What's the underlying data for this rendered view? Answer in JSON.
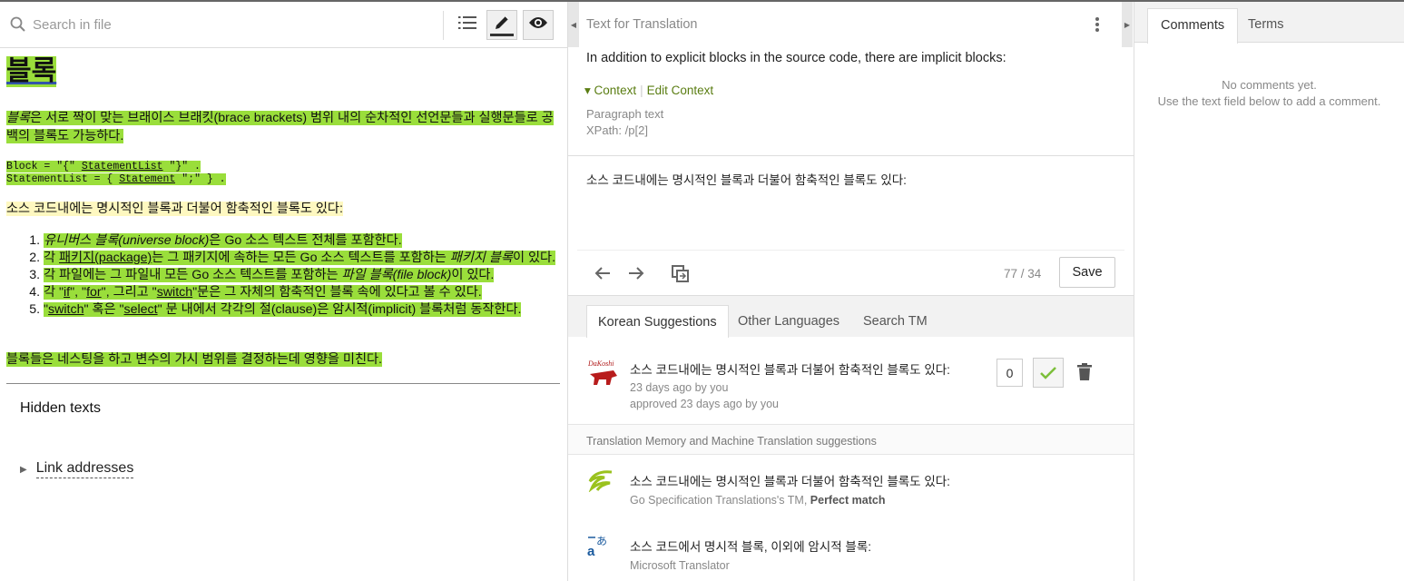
{
  "left": {
    "search_placeholder": "Search in file",
    "doc": {
      "heading": "블록",
      "p1_em": "블록",
      "p1_rest": "은 서로 짝이 맞는 브래이스 브래킷(brace brackets) 범위 내의 순차적인 선언문들과 실행문들로 공백의 블록도 가능하다.",
      "code_line1_a": "Block = \"{\" ",
      "code_line1_link": "StatementList",
      "code_line1_b": " \"}\" .",
      "code_line2_a": "StatementList = { ",
      "code_line2_link": "Statement",
      "code_line2_b": " \";\" } .",
      "p2": "소스 코드내에는 명시적인 블록과 더불어 함축적인 블록도 있다:",
      "items": [
        {
          "parts": [
            {
              "t": "유니버스 블록(universe block)",
              "em": true
            },
            {
              "t": "은 Go 소스 텍스트 전체를 포함한다."
            }
          ]
        },
        {
          "parts": [
            {
              "t": "각 "
            },
            {
              "t": "패키지(package)",
              "u": true
            },
            {
              "t": "는 그 패키지에 속하는 모든 Go 소스 텍스트를 포함하는 "
            },
            {
              "t": "패키지 블록",
              "em": true
            },
            {
              "t": "이 있다."
            }
          ]
        },
        {
          "parts": [
            {
              "t": "각 파일에는 그 파일내 모든 Go 소스 텍스트를 포함하는 "
            },
            {
              "t": "파일 블록(file block)",
              "em": true
            },
            {
              "t": "이 있다."
            }
          ]
        },
        {
          "parts": [
            {
              "t": "각 \""
            },
            {
              "t": "if",
              "u": true
            },
            {
              "t": "\", \""
            },
            {
              "t": "for",
              "u": true
            },
            {
              "t": "\", 그리고 \""
            },
            {
              "t": "switch",
              "u": true
            },
            {
              "t": "\"문은 그 자체의 함축적인 블록 속에 있다고 볼 수 있다."
            }
          ]
        },
        {
          "parts": [
            {
              "t": "\""
            },
            {
              "t": "switch",
              "u": true
            },
            {
              "t": "\" 혹은 \""
            },
            {
              "t": "select",
              "u": true
            },
            {
              "t": "\" 문 내에서 각각의 절(clause)은 암시적(implicit) 블록처럼 동작한다."
            }
          ]
        }
      ],
      "p3": "블록들은 네스팅을 하고 변수의 가시 범위를 결정하는데 영향을 미친다."
    },
    "hidden_texts": "Hidden texts",
    "link_addresses": "Link addresses"
  },
  "middle": {
    "header": "Text for Translation",
    "source_text": "In addition to explicit blocks in the source code, there are implicit blocks:",
    "context_label": "Context",
    "edit_context_label": "Edit Context",
    "meta_type": "Paragraph text",
    "meta_xpath": "XPath: /p[2]",
    "translation": "소스 코드내에는 명시적인 블록과 더불어 함축적인 블록도 있다:",
    "counter": "77 / 34",
    "save_label": "Save",
    "tabs": [
      "Korean Suggestions",
      "Other Languages",
      "Search TM"
    ],
    "suggestion": {
      "text": "소스 코드내에는 명시적인 블록과 더불어 함축적인 블록도 있다:",
      "time": "23 days ago by you",
      "approved": "approved 23 days ago by you",
      "votes": "0",
      "avatar_label": "DaKoshi"
    },
    "tm_header": "Translation Memory and Machine Translation suggestions",
    "tm": [
      {
        "text": "소스 코드내에는 명시적인 블록과 더불어 함축적인 블록도 있다:",
        "source": "Go Specification Translations's TM, ",
        "match": "Perfect match"
      },
      {
        "text": "소스 코드에서 명시적 블록, 이외에 암시적 블록:",
        "source": "Microsoft Translator"
      }
    ]
  },
  "right": {
    "tabs": [
      "Comments",
      "Terms"
    ],
    "no_comments": "No comments yet.",
    "hint": "Use the text field below to add a comment."
  },
  "colors": {
    "highlight": "#9ade3b",
    "pale_highlight": "#fef8c0",
    "context_green": "#5a7d12",
    "check_green": "#7cbf3a"
  }
}
